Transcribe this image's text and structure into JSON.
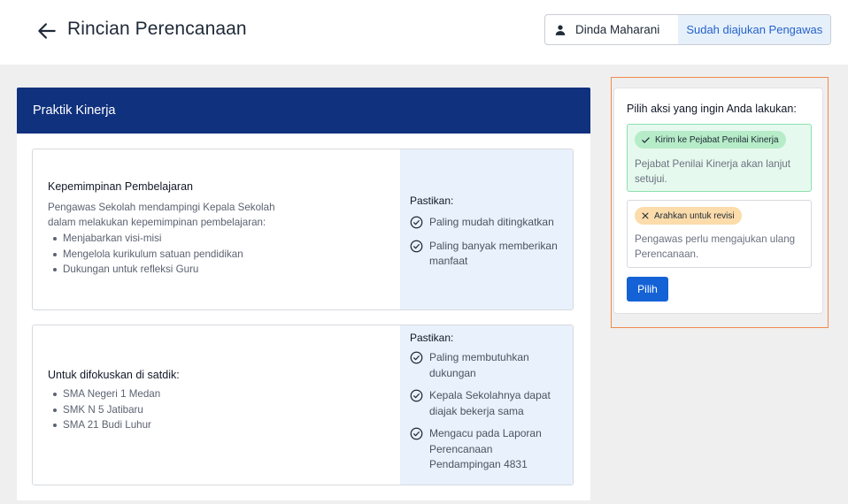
{
  "header": {
    "title": "Rincian Perencanaan",
    "back_icon": "arrow-left-icon",
    "user_icon": "person-icon",
    "user_name": "Dinda Maharani",
    "status": "Sudah diajukan Pengawas"
  },
  "main": {
    "section_title": "Praktik Kinerja",
    "blocks": [
      {
        "title": "Kepemimpinan Pembelajaran",
        "description": [
          "Pengawas Sekolah mendampingi Kepala Sekolah",
          "dalam melakukan kepemimpinan pembelajaran:"
        ],
        "bullets": [
          "Menjabarkan visi-misi",
          "Mengelola kurikulum satuan pendidikan",
          "Dukungan untuk refleksi Guru"
        ],
        "checklist_title": "Pastikan:",
        "checklist": [
          [
            "Paling mudah ditingkatkan"
          ],
          [
            "Paling banyak memberikan",
            "manfaat"
          ]
        ]
      },
      {
        "title": "Untuk difokuskan di satdik:",
        "bullets": [
          "SMA Negeri 1 Medan",
          "SMK N 5 Jatibaru",
          "SMA 21 Budi Luhur"
        ],
        "checklist_title": "Pastikan:",
        "checklist": [
          [
            "Paling membutuhkan",
            "dukungan"
          ],
          [
            "Kepala Sekolahnya dapat",
            "diajak bekerja sama"
          ],
          [
            "Mengacu pada Laporan",
            "Perencanaan",
            "Pendampingan 4831"
          ]
        ]
      }
    ]
  },
  "actions": {
    "title": "Pilih aksi yang ingin Anda lakukan:",
    "options": [
      {
        "chip": "Kirim ke Pejabat Penilai Kinerja",
        "icon": "check-icon",
        "description": [
          "Pejabat Penilai Kinerja akan lanjut",
          "setujui."
        ]
      },
      {
        "chip": "Arahkan untuk revisi",
        "icon": "x-icon",
        "description": [
          "Pengawas perlu mengajukan ulang",
          "Perencanaan."
        ]
      }
    ],
    "submit_label": "Pilih"
  },
  "colors": {
    "header_blue": "#10317d",
    "primary_button": "#1462d6",
    "status_bg": "#e6f0fb",
    "checklist_bg": "#e9f1fc",
    "option_selected_bg": "#e6f9ee",
    "chip_green": "#b6ecc8",
    "chip_orange": "#fbdcaa",
    "highlight_border": "#f08a4b"
  }
}
